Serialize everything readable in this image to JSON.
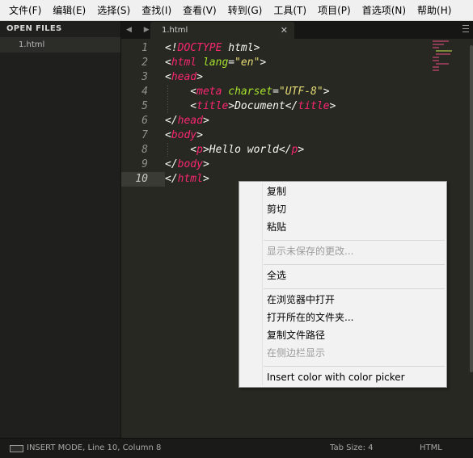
{
  "menubar": {
    "items": [
      "文件(F)",
      "编辑(E)",
      "选择(S)",
      "查找(I)",
      "查看(V)",
      "转到(G)",
      "工具(T)",
      "项目(P)",
      "首选项(N)",
      "帮助(H)"
    ]
  },
  "sidebar": {
    "header": "OPEN FILES",
    "files": [
      "1.html"
    ]
  },
  "tabs": {
    "nav": "◀ ▶",
    "active_label": "1.html",
    "close": "✕"
  },
  "editor": {
    "line_numbers": [
      "1",
      "2",
      "3",
      "4",
      "5",
      "6",
      "7",
      "8",
      "9",
      "10"
    ],
    "active_line": 10,
    "lines": [
      [
        {
          "t": "<!",
          "c": ""
        },
        {
          "t": "DOCTYPE",
          "c": "tag"
        },
        {
          "t": " html>",
          "c": ""
        }
      ],
      [
        {
          "t": "<",
          "c": ""
        },
        {
          "t": "html",
          "c": "tag"
        },
        {
          "t": " ",
          "c": ""
        },
        {
          "t": "lang",
          "c": "attr"
        },
        {
          "t": "=",
          "c": ""
        },
        {
          "t": "\"en\"",
          "c": "str"
        },
        {
          "t": ">",
          "c": ""
        }
      ],
      [
        {
          "t": "<",
          "c": ""
        },
        {
          "t": "head",
          "c": "tag"
        },
        {
          "t": ">",
          "c": ""
        }
      ],
      [
        {
          "t": "    <",
          "c": ""
        },
        {
          "t": "meta",
          "c": "tag"
        },
        {
          "t": " ",
          "c": ""
        },
        {
          "t": "charset",
          "c": "attr"
        },
        {
          "t": "=",
          "c": ""
        },
        {
          "t": "\"UTF-8\"",
          "c": "str"
        },
        {
          "t": ">",
          "c": ""
        }
      ],
      [
        {
          "t": "    <",
          "c": ""
        },
        {
          "t": "title",
          "c": "tag"
        },
        {
          "t": ">Document</",
          "c": ""
        },
        {
          "t": "title",
          "c": "tag"
        },
        {
          "t": ">",
          "c": ""
        }
      ],
      [
        {
          "t": "</",
          "c": ""
        },
        {
          "t": "head",
          "c": "tag"
        },
        {
          "t": ">",
          "c": ""
        }
      ],
      [
        {
          "t": "<",
          "c": ""
        },
        {
          "t": "body",
          "c": "tag"
        },
        {
          "t": ">",
          "c": ""
        }
      ],
      [
        {
          "t": "    <",
          "c": ""
        },
        {
          "t": "p",
          "c": "tag"
        },
        {
          "t": ">Hello world</",
          "c": ""
        },
        {
          "t": "p",
          "c": "tag"
        },
        {
          "t": ">",
          "c": ""
        }
      ],
      [
        {
          "t": "</",
          "c": ""
        },
        {
          "t": "body",
          "c": "tag"
        },
        {
          "t": ">",
          "c": ""
        }
      ],
      [
        {
          "t": "</",
          "c": ""
        },
        {
          "t": "html",
          "c": "tag"
        },
        {
          "t": ">",
          "c": ""
        }
      ]
    ]
  },
  "context_menu": {
    "copy": "复制",
    "cut": "剪切",
    "paste": "粘贴",
    "show_unsaved": "显示未保存的更改...",
    "select_all": "全选",
    "open_in_browser": "在浏览器中打开",
    "open_containing_folder": "打开所在的文件夹...",
    "copy_file_path": "复制文件路径",
    "reveal_in_sidebar": "在侧边栏显示",
    "insert_color": "Insert color with color picker"
  },
  "statusbar": {
    "mode": "INSERT MODE, Line 10, Column 8",
    "tab_size": "Tab Size: 4",
    "syntax": "HTML"
  },
  "colors": {
    "tag": "#f92672",
    "attribute": "#a6e22e",
    "string": "#e6db74",
    "text": "#f8f8f2",
    "editor_bg": "#272822"
  }
}
